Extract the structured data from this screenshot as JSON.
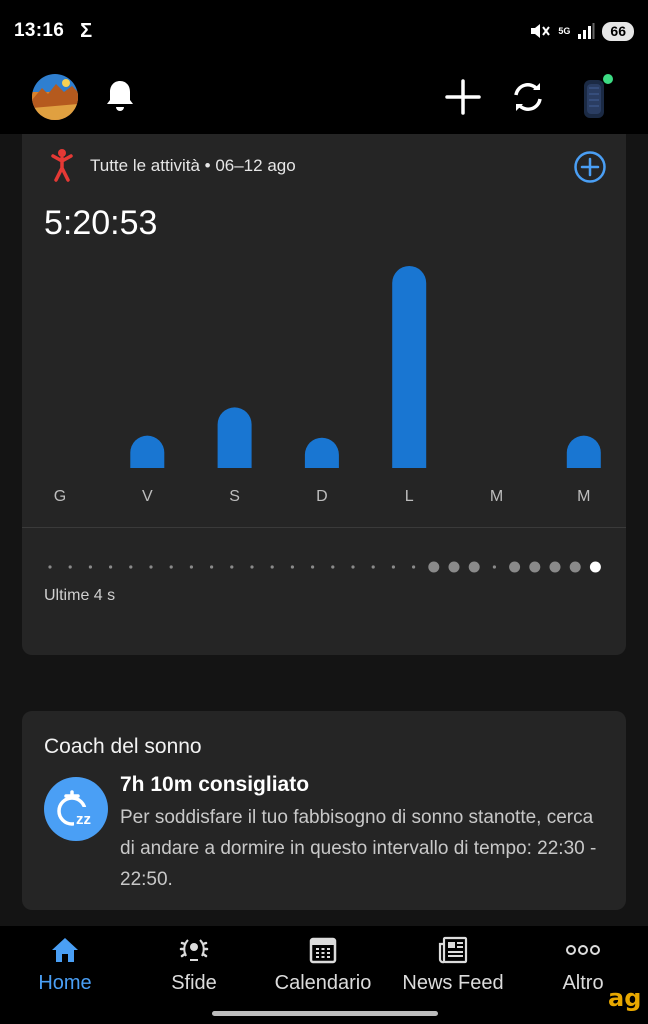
{
  "status_bar": {
    "time": "13:16",
    "sigma": "Σ",
    "network": "5G",
    "battery": "66"
  },
  "app_bar": {
    "icons": [
      "avatar",
      "bell-icon",
      "plus-icon",
      "sync-icon",
      "device-icon"
    ],
    "device_status_color": "#3ddc84"
  },
  "activity_card": {
    "title": "Tutte le attività • 06–12 ago",
    "total_time": "5:20:53",
    "period_label": "Ultime 4 s",
    "accent_color": "#1976d2",
    "pager": {
      "count": 28,
      "active_index": 27,
      "filled": [
        19,
        20,
        21,
        23,
        24,
        25,
        26
      ]
    }
  },
  "chart_data": {
    "type": "bar",
    "categories": [
      "G",
      "V",
      "S",
      "D",
      "L",
      "M",
      "M"
    ],
    "values": [
      0,
      0.16,
      0.3,
      0.15,
      1.0,
      0,
      0.16
    ],
    "title": "",
    "xlabel": "",
    "ylabel": "",
    "grid": false
  },
  "sleep_card": {
    "title": "Coach del sonno",
    "heading": "7h 10m consigliato",
    "body": "Per soddisfare il tuo fabbisogno di sonno stanotte, cerca di andare a dormire in questo intervallo di tempo: 22:30 - 22:50.",
    "icon": "sleep-zz-icon",
    "icon_color": "#4a9ff5"
  },
  "nav": {
    "active_color": "#4a9ff5",
    "items": [
      {
        "label": "Home",
        "icon": "home-icon"
      },
      {
        "label": "Sfide",
        "icon": "laurel-icon"
      },
      {
        "label": "Calendario",
        "icon": "calendar-icon"
      },
      {
        "label": "News Feed",
        "icon": "newsfeed-icon"
      },
      {
        "label": "Altro",
        "icon": "more-icon"
      }
    ]
  },
  "watermark": "ag"
}
